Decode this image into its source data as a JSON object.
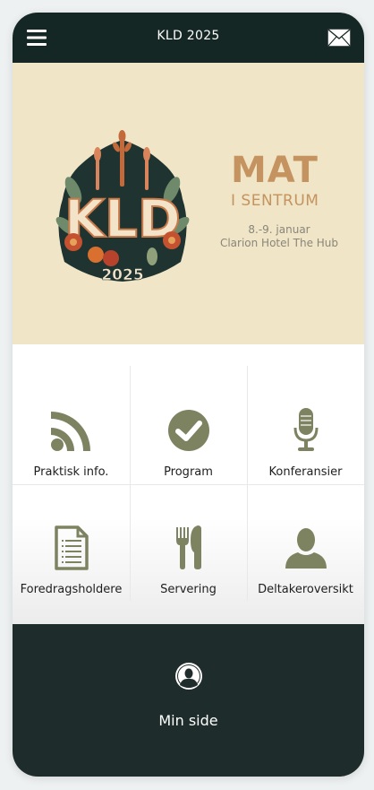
{
  "header": {
    "title": "KLD 2025",
    "menu_icon": "hamburger-menu-icon",
    "mail_icon": "envelope-icon"
  },
  "hero": {
    "logo_text": "KLD",
    "logo_year": "2025",
    "headline": "MAT",
    "subheadline": "I SENTRUM",
    "date": "8.-9. januar",
    "venue": "Clarion Hotel The Hub"
  },
  "menu": {
    "items": [
      {
        "label": "Praktisk info.",
        "icon": "rss-feed-icon"
      },
      {
        "label": "Program",
        "icon": "checkmark-circle-icon"
      },
      {
        "label": "Konferansier",
        "icon": "microphone-icon"
      },
      {
        "label": "Foredragsholdere",
        "icon": "document-icon"
      },
      {
        "label": "Servering",
        "icon": "fork-knife-icon"
      },
      {
        "label": "Deltakeroversikt",
        "icon": "person-icon"
      }
    ]
  },
  "footer": {
    "label": "Min side",
    "icon": "user-profile-icon"
  },
  "colors": {
    "header_bg": "#152724",
    "hero_bg": "#f0e6c7",
    "accent": "#c4935f",
    "icon_olive": "#7d8360",
    "footer_bg": "#1e2d2b"
  }
}
